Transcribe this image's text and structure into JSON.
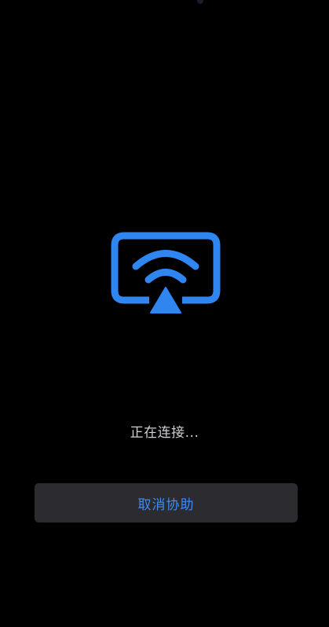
{
  "status_text": "正在连接...",
  "cancel_button_label": "取消协助",
  "icon": "screen-share-icon",
  "colors": {
    "background": "#000000",
    "accent": "#2f86f0",
    "button_background": "#2b2b30",
    "button_text": "#3f8cf2",
    "status_text": "#cfcfd4"
  }
}
